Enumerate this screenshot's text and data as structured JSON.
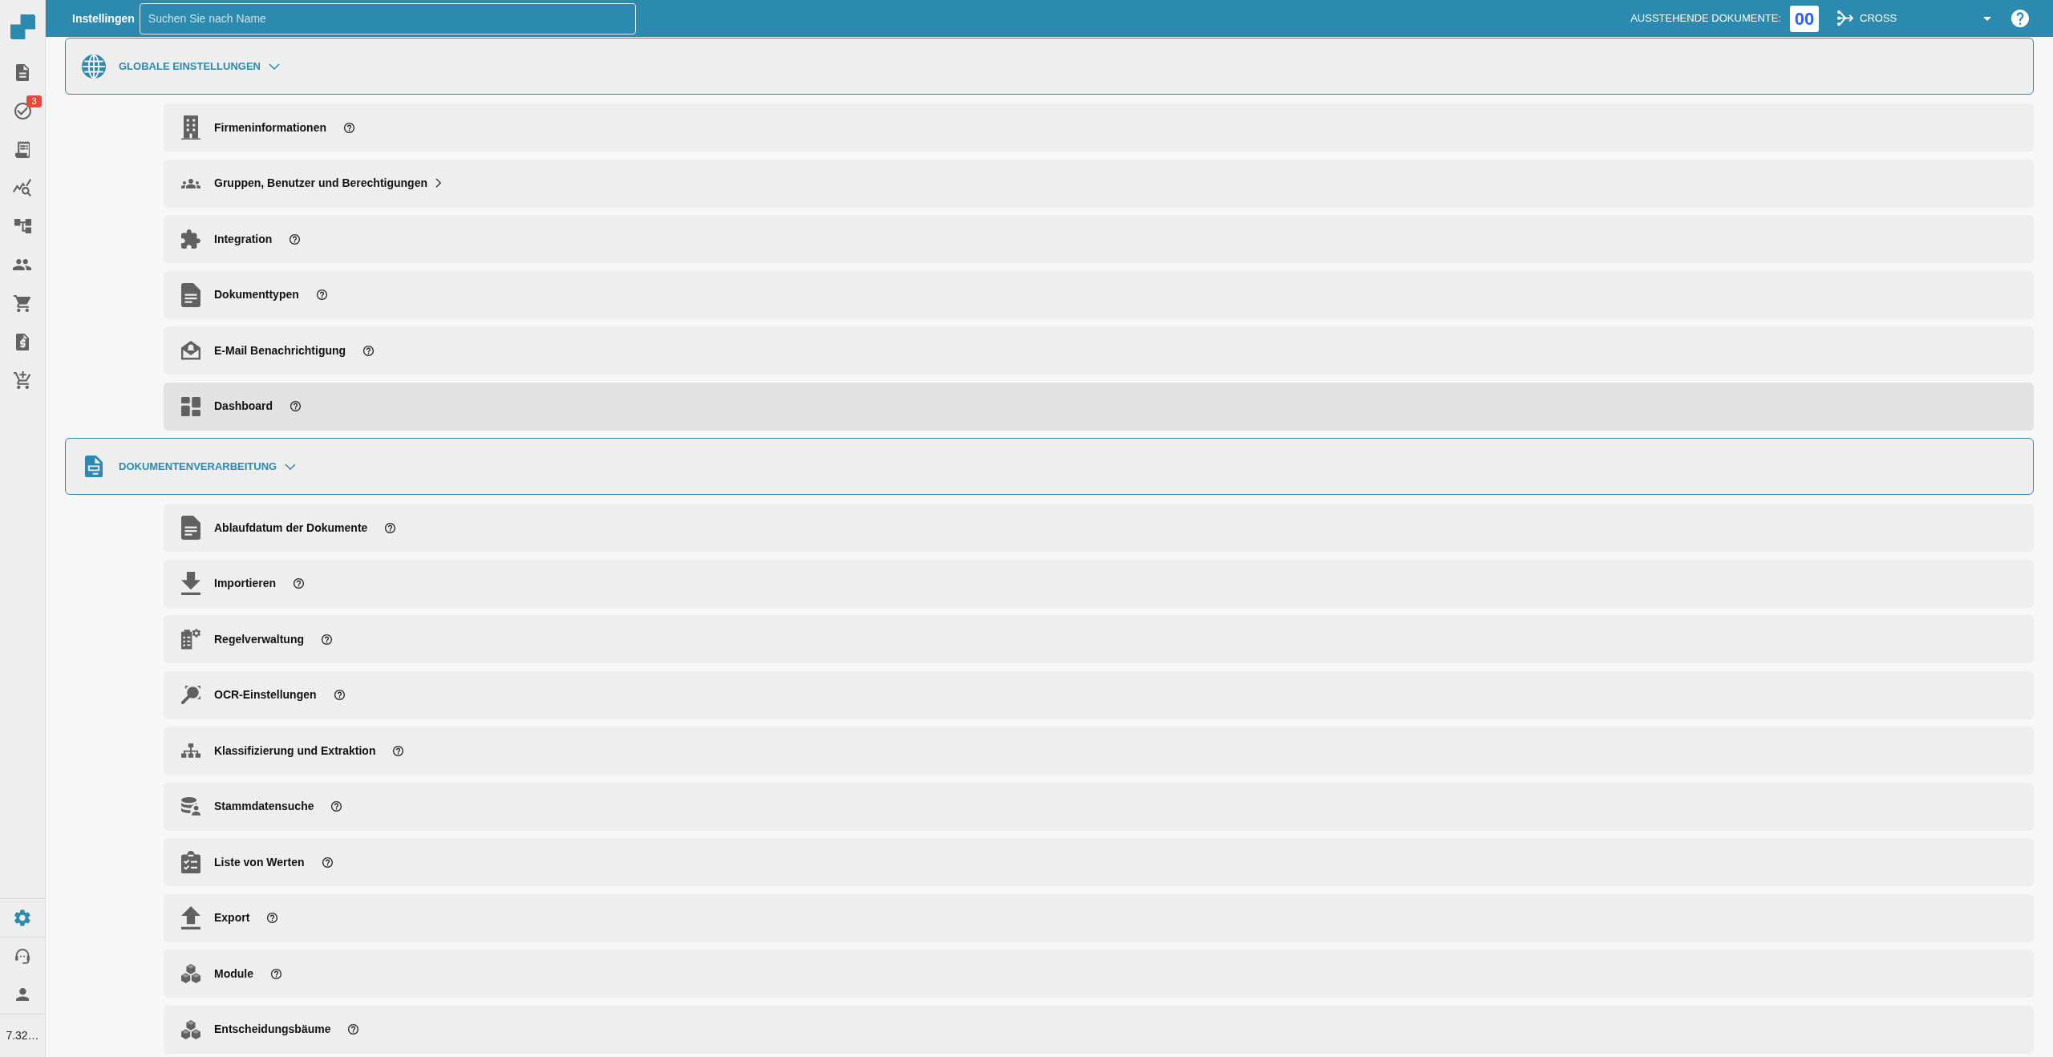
{
  "sidebar": {
    "nav_items": [
      {
        "selected": false
      },
      {
        "selected": false,
        "badge": "3"
      },
      {
        "selected": false
      },
      {
        "selected": false
      },
      {
        "selected": false
      },
      {
        "selected": false
      },
      {
        "selected": false
      },
      {
        "selected": false
      },
      {
        "selected": false
      }
    ],
    "footer_items": [
      {
        "selected": true
      },
      {
        "selected": false
      },
      {
        "selected": false
      }
    ],
    "version": "7.32…"
  },
  "topbar": {
    "title": "Instellingen",
    "search": {
      "placeholder": "Suchen Sie nach Name"
    },
    "pending_label": "AUSSTEHENDE DOKUMENTE:",
    "pending_count": "00",
    "workflow": "CROSS"
  },
  "sections": [
    {
      "title": "GLOBALE EINSTELLUNGEN",
      "expanded": true,
      "items": [
        {
          "label": "Firmeninformationen",
          "kind": "help",
          "selected": false
        },
        {
          "label": "Gruppen, Benutzer und Berechtigungen",
          "kind": "submenu",
          "selected": false
        },
        {
          "label": "Integration",
          "kind": "help",
          "selected": false
        },
        {
          "label": "Dokumenttypen",
          "kind": "help",
          "selected": false
        },
        {
          "label": "E-Mail Benachrichtigung",
          "kind": "help",
          "selected": false
        },
        {
          "label": "Dashboard",
          "kind": "help",
          "selected": true
        }
      ]
    },
    {
      "title": "DOKUMENTENVERARBEITUNG",
      "expanded": true,
      "items": [
        {
          "label": "Ablaufdatum der Dokumente",
          "kind": "help",
          "selected": false
        },
        {
          "label": "Importieren",
          "kind": "help",
          "selected": false
        },
        {
          "label": "Regelverwaltung",
          "kind": "help",
          "selected": false
        },
        {
          "label": "OCR-Einstellungen",
          "kind": "help",
          "selected": false
        },
        {
          "label": "Klassifizierung und Extraktion",
          "kind": "help",
          "selected": false
        },
        {
          "label": "Stammdatensuche",
          "kind": "help",
          "selected": false
        },
        {
          "label": "Liste von Werten",
          "kind": "help",
          "selected": false
        },
        {
          "label": "Export",
          "kind": "help",
          "selected": false
        },
        {
          "label": "Module",
          "kind": "help",
          "selected": false
        },
        {
          "label": "Entscheidungsbäume",
          "kind": "help",
          "selected": false
        }
      ]
    }
  ]
}
